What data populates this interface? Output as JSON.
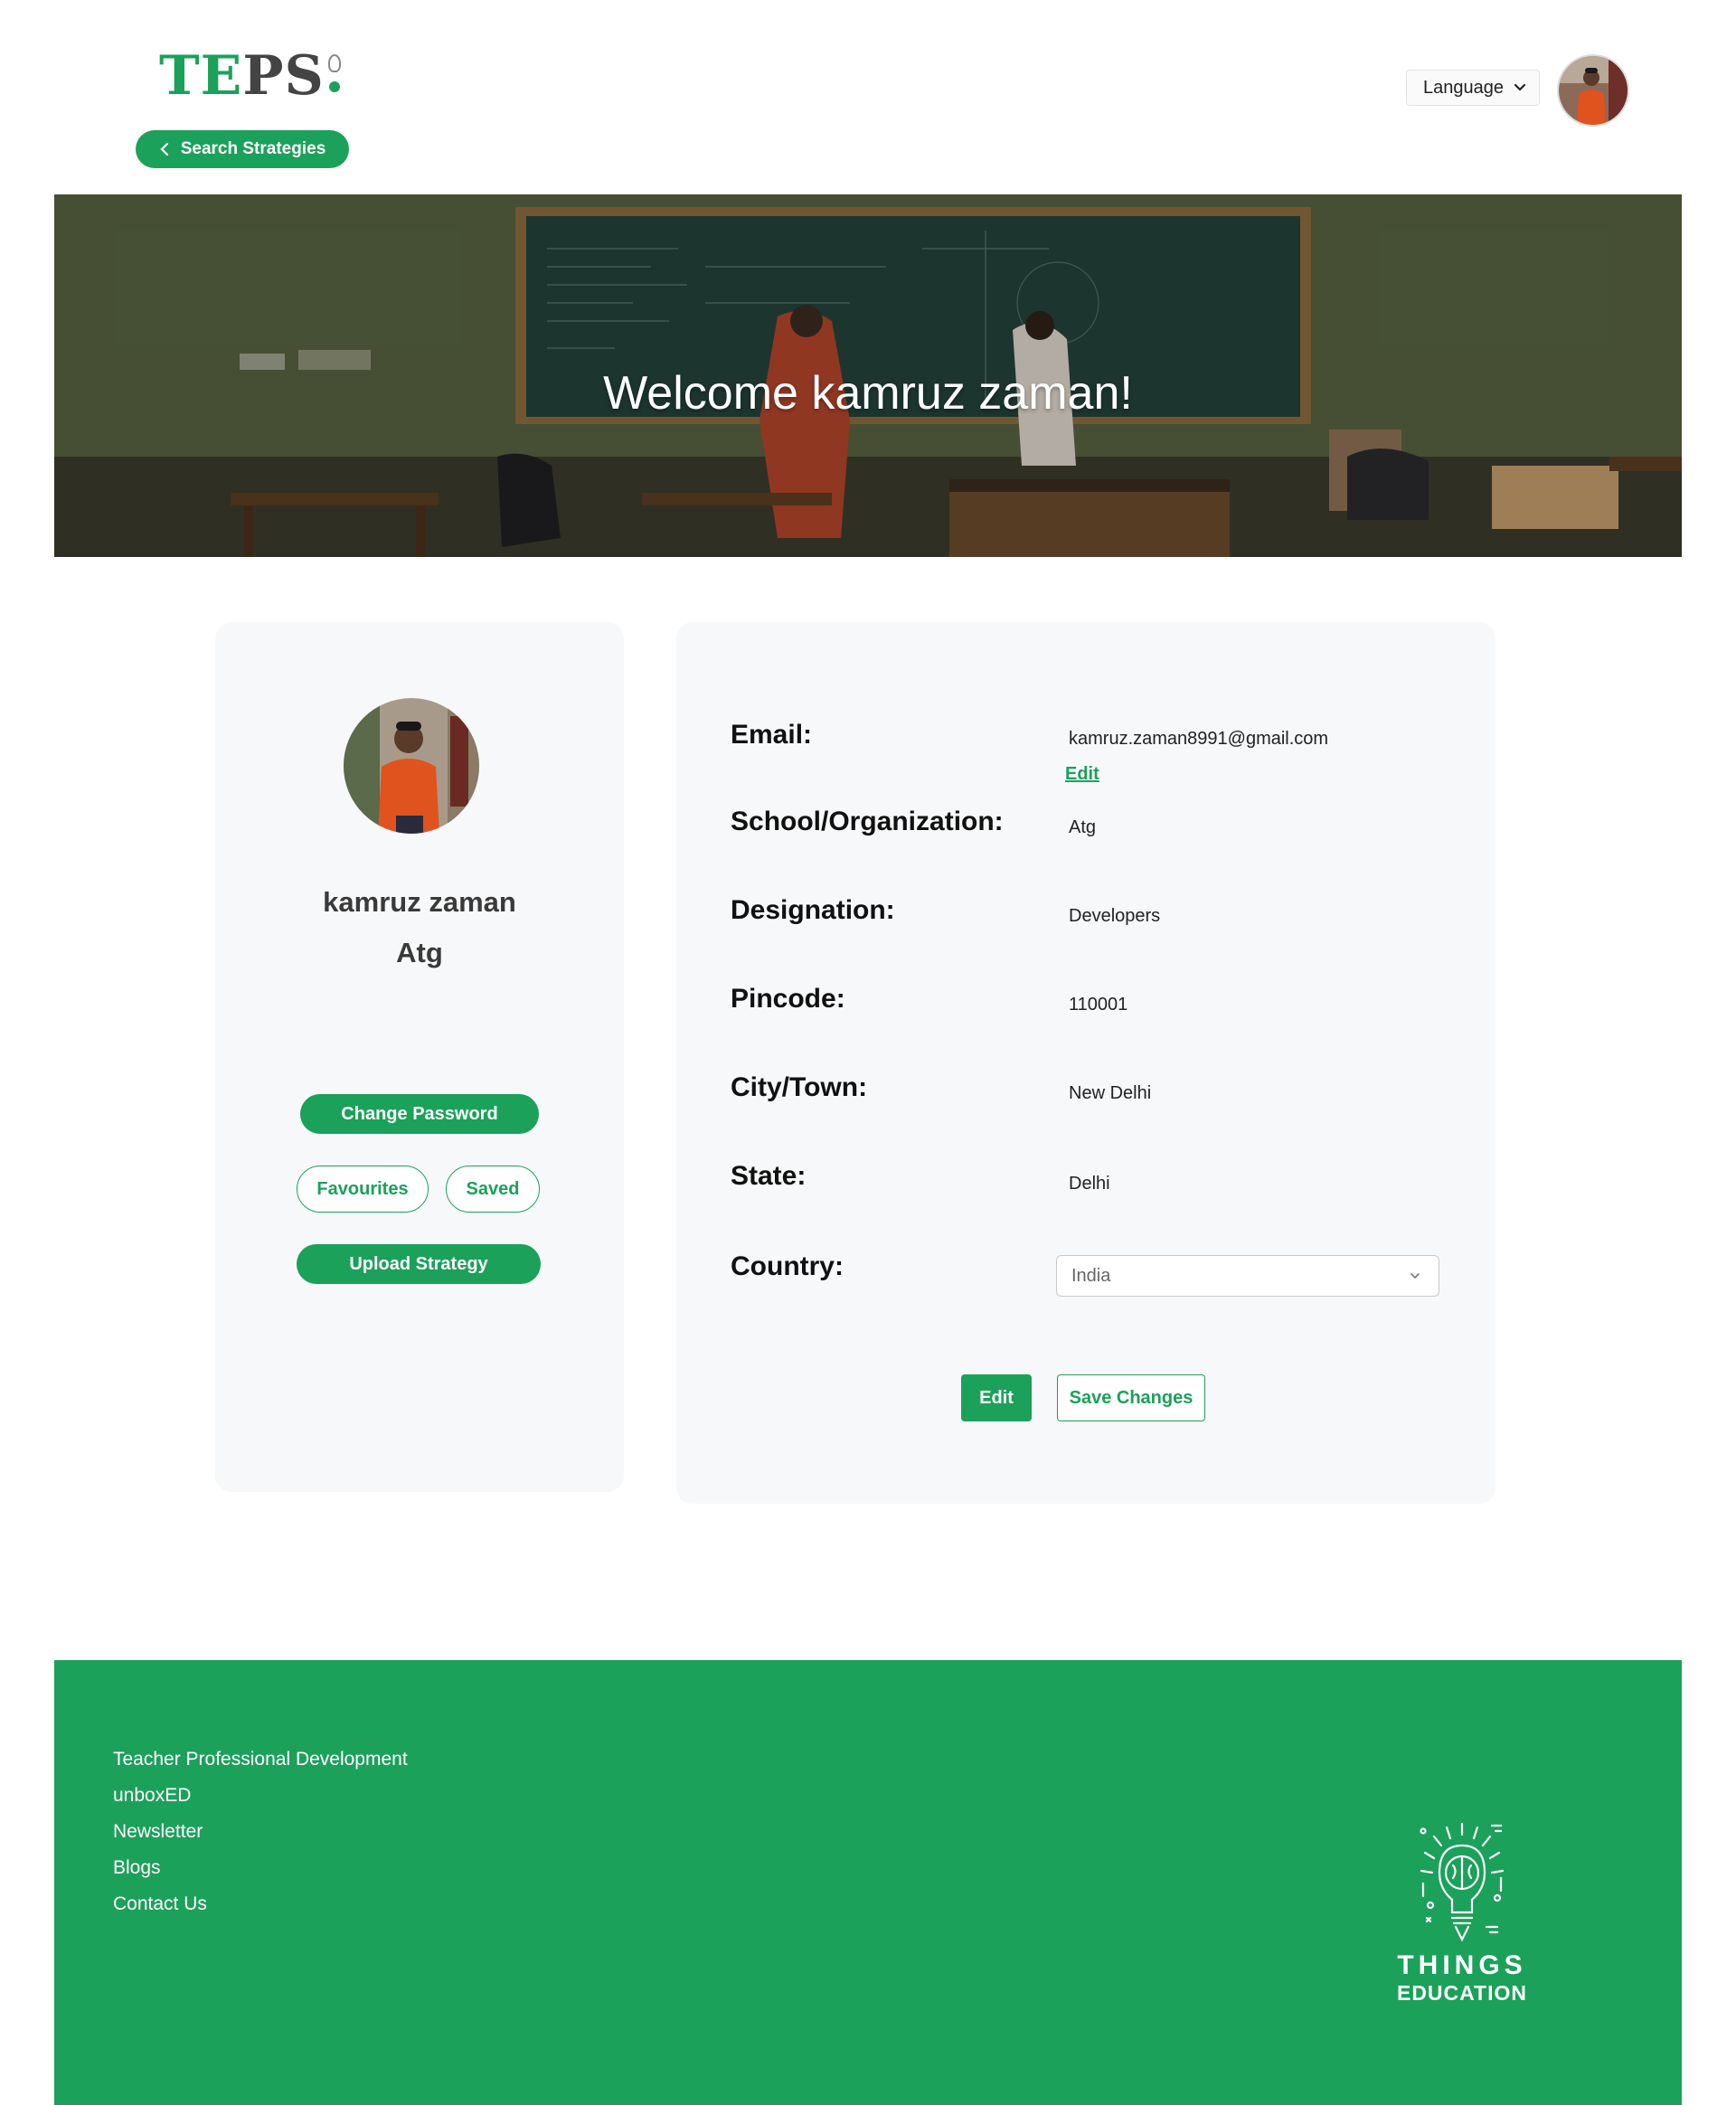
{
  "header": {
    "logo_text_main": "TE",
    "logo_text_rest": "PS",
    "back_button_label": "Search Strategies",
    "language_label": "Language"
  },
  "hero": {
    "welcome_text": "Welcome kamruz zaman!"
  },
  "profile": {
    "name": "kamruz zaman",
    "organization": "Atg",
    "buttons": {
      "change_password": "Change Password",
      "favourites": "Favourites",
      "saved": "Saved",
      "upload_strategy": "Upload Strategy"
    }
  },
  "details": {
    "email_label": "Email:",
    "email_value": "kamruz.zaman8991@gmail.com",
    "email_edit": "Edit",
    "school_label": "School/Organization:",
    "school_value": "Atg",
    "designation_label": "Designation:",
    "designation_value": "Developers",
    "pincode_label": "Pincode:",
    "pincode_value": "110001",
    "city_label": "City/Town:",
    "city_value": "New Delhi",
    "state_label": "State:",
    "state_value": "Delhi",
    "country_label": "Country:",
    "country_value": "India",
    "edit_button": "Edit",
    "save_button": "Save Changes"
  },
  "footer": {
    "links": [
      "Teacher Professional Development",
      "unboxED",
      "Newsletter",
      "Blogs",
      "Contact Us"
    ],
    "logo_title": "THINGS",
    "logo_subtitle": "EDUCATION"
  },
  "colors": {
    "brand_green": "#1ba15a",
    "card_bg": "#f7f8f9",
    "text_dark": "#111111"
  },
  "icons": [
    "chevron-left-icon",
    "chevron-down-icon",
    "lightbulb-brain-icon"
  ]
}
